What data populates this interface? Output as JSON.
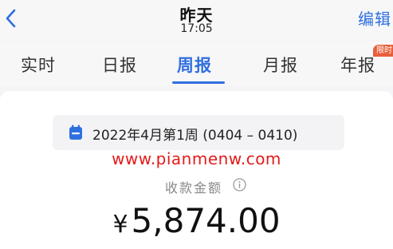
{
  "header": {
    "title": "昨天",
    "subtitle": "17:05",
    "edit_label": "编辑",
    "back_icon": "chevron-left-icon"
  },
  "tabs": [
    {
      "label": "实时",
      "active": false
    },
    {
      "label": "日报",
      "active": false
    },
    {
      "label": "周报",
      "active": true
    },
    {
      "label": "月报",
      "active": false
    },
    {
      "label": "年报",
      "active": false,
      "badge": "限时"
    }
  ],
  "card": {
    "date_range": "2022年4月第1周 (0404 – 0410)",
    "watermark": "www.pianmenw.com",
    "amount_label": "收款金额",
    "currency": "¥",
    "amount": "5,874.00"
  },
  "colors": {
    "accent": "#2f6fe0",
    "watermark": "#e31b1b",
    "badge": "#e8603c"
  }
}
